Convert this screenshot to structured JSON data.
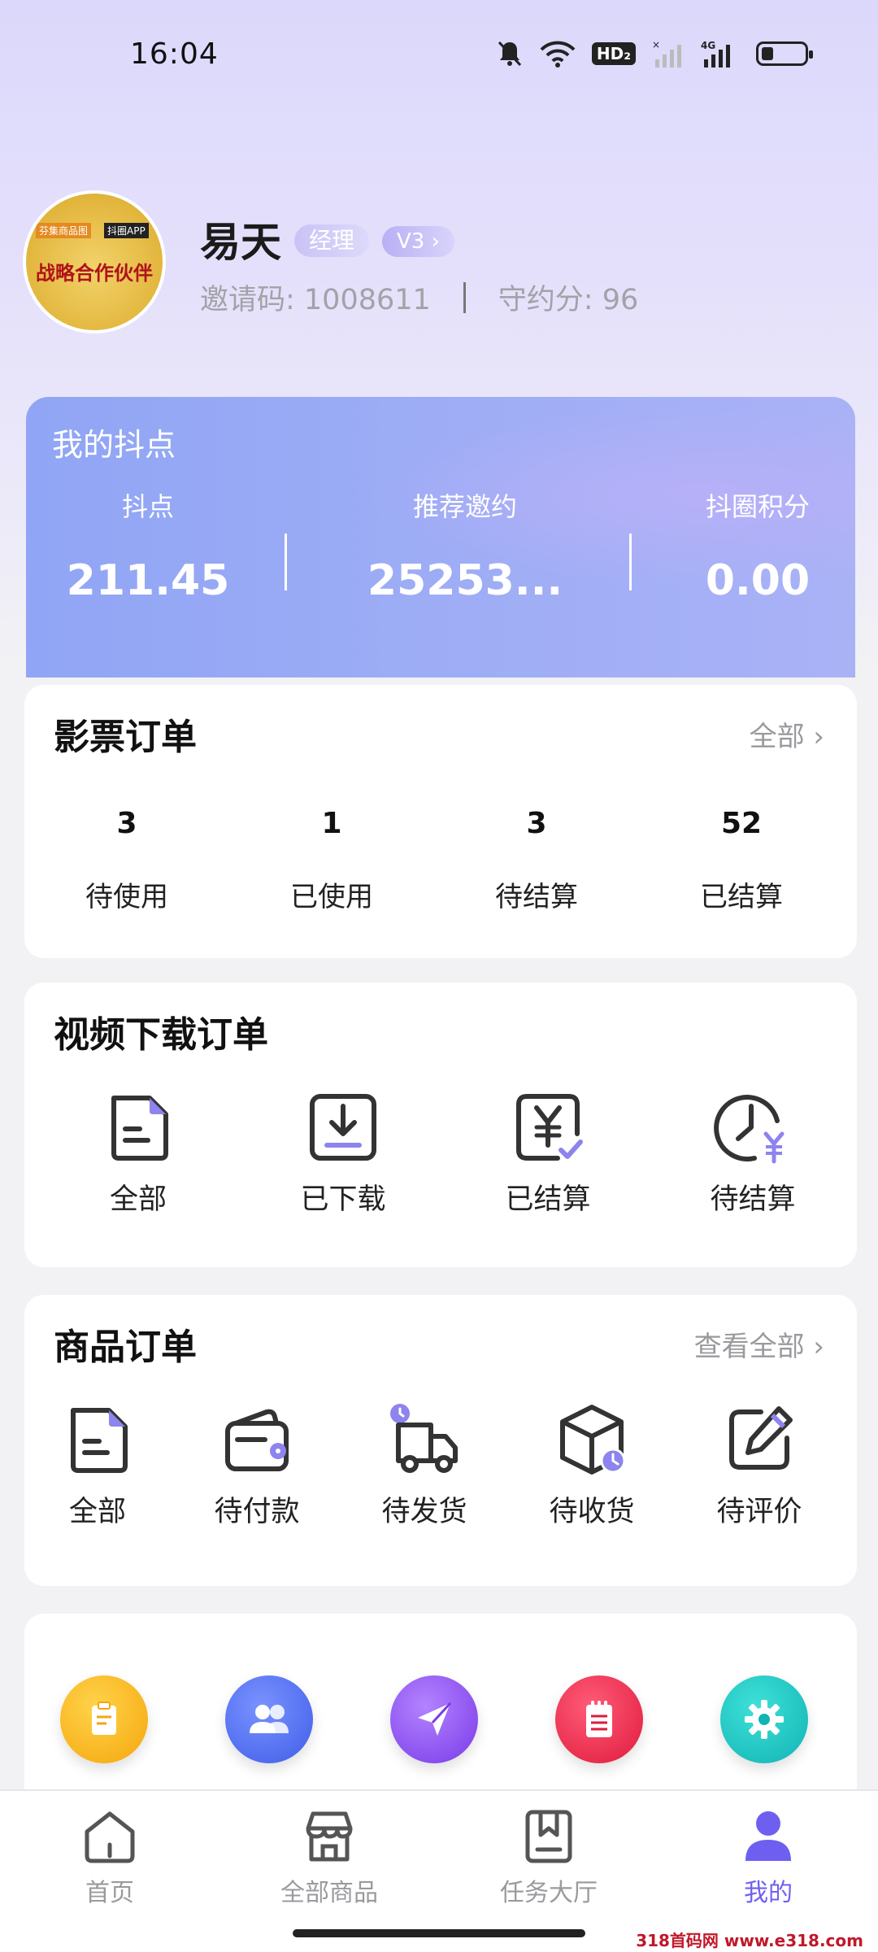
{
  "status_bar": {
    "time": "16:04",
    "network_badge": "HD₂",
    "network_type": "4G"
  },
  "profile": {
    "avatar_text": "战略合作伙伴",
    "avatar_brand_left": "芬集商品图",
    "avatar_brand_right": "抖圈APP",
    "name": "易天",
    "role": "经理",
    "level": "V3 ›",
    "invite_text": "邀请码: 1008611",
    "credit_text": "守约分: 96"
  },
  "points": {
    "title": "我的抖点",
    "items": [
      {
        "label": "抖点",
        "value": "211.45"
      },
      {
        "label": "推荐邀约",
        "value": "25253..."
      },
      {
        "label": "抖圈积分",
        "value": "0.00"
      }
    ]
  },
  "movie_orders": {
    "title": "影票订单",
    "link": "全部 ›",
    "items": [
      {
        "count": "3",
        "label": "待使用"
      },
      {
        "count": "1",
        "label": "已使用"
      },
      {
        "count": "3",
        "label": "待结算"
      },
      {
        "count": "52",
        "label": "已结算"
      }
    ]
  },
  "video_orders": {
    "title": "视频下载订单",
    "items": [
      {
        "label": "全部",
        "icon": "document-icon"
      },
      {
        "label": "已下载",
        "icon": "download-icon"
      },
      {
        "label": "已结算",
        "icon": "yen-check-icon"
      },
      {
        "label": "待结算",
        "icon": "clock-yen-icon"
      }
    ]
  },
  "goods_orders": {
    "title": "商品订单",
    "link": "查看全部 ›",
    "items": [
      {
        "label": "全部",
        "icon": "document-icon"
      },
      {
        "label": "待付款",
        "icon": "wallet-icon"
      },
      {
        "label": "待发货",
        "icon": "truck-icon"
      },
      {
        "label": "待收货",
        "icon": "box-icon"
      },
      {
        "label": "待评价",
        "icon": "edit-icon"
      }
    ]
  },
  "tools": [
    {
      "icon": "clipboard-icon",
      "color": "#f8b31a"
    },
    {
      "icon": "users-icon",
      "color": "#4f6ef0"
    },
    {
      "icon": "send-icon",
      "color": "#8e4ff0"
    },
    {
      "icon": "notepad-icon",
      "color": "#e8284a"
    },
    {
      "icon": "gear-icon",
      "color": "#18c4c4"
    }
  ],
  "bottom_nav": [
    {
      "label": "首页",
      "icon": "home-icon"
    },
    {
      "label": "全部商品",
      "icon": "store-icon"
    },
    {
      "label": "任务大厅",
      "icon": "bookmark-icon"
    },
    {
      "label": "我的",
      "icon": "user-icon",
      "active": true
    }
  ],
  "accent_color": "#6f5ff0",
  "watermark": "318首码网 www.e318.com"
}
